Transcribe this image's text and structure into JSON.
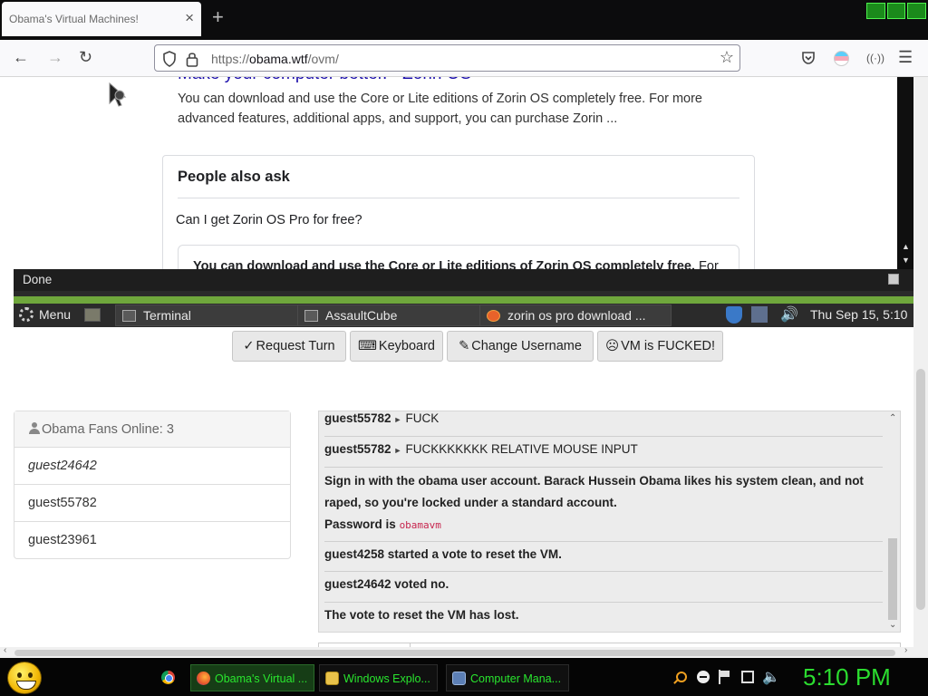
{
  "browser": {
    "tab_title": "Obama's Virtual Machines!",
    "tab_close": "×",
    "new_tab": "+",
    "url_prefix": "https://",
    "url_domain": "obama.wtf",
    "url_path": "/ovm/"
  },
  "vm_screen": {
    "result_heading": "Make your computer better. - Zorin OS",
    "result_snippet": "You can download and use the Core or Lite editions of Zorin OS completely free. For more advanced features, additional apps, and support, you can purchase Zorin ...",
    "paa_title": "People also ask",
    "paa_question": "Can I get Zorin OS Pro for free?",
    "paa_answer_bold": "You can download and use the Core or Lite editions of Zorin OS completely free.",
    "paa_answer_rest": " For",
    "status_text": "Done",
    "panel": {
      "menu_label": "Menu",
      "tasks": [
        "Terminal",
        "AssaultCube",
        "zorin os pro download ..."
      ],
      "clock": "Thu Sep 15,  5:10"
    }
  },
  "toolbar": {
    "request_turn": "Request Turn",
    "keyboard": "Keyboard",
    "change_username": "Change Username",
    "vm_broken": "VM is FUCKED!"
  },
  "users": {
    "header": "Obama Fans Online: 3",
    "list": [
      "guest24642",
      "guest55782",
      "guest23961"
    ]
  },
  "chat": {
    "messages": [
      {
        "user": "guest55782",
        "text": "FUCK"
      },
      {
        "user": "guest55782",
        "text": "FUCKKKKKKK RELATIVE MOUSE INPUT"
      }
    ],
    "motd_text": "Sign in with the obama user account. Barack Hussein Obama likes his system clean, and not raped, so you're locked under a standard account.",
    "password_label": "Password is",
    "password_value": "obamavm",
    "system_lines": [
      "guest4258 started a vote to reset the VM.",
      "guest24642 voted no.",
      "The vote to reset the VM has lost."
    ]
  },
  "taskbar": {
    "tasks": [
      "Obama's Virtual ...",
      "Windows Explo...",
      "Computer Mana..."
    ],
    "clock": "5:10 PM"
  },
  "colors": {
    "taskbar_text": "#29e62e",
    "mint_green": "#6fa73c",
    "link_blue": "#1a0dab"
  }
}
